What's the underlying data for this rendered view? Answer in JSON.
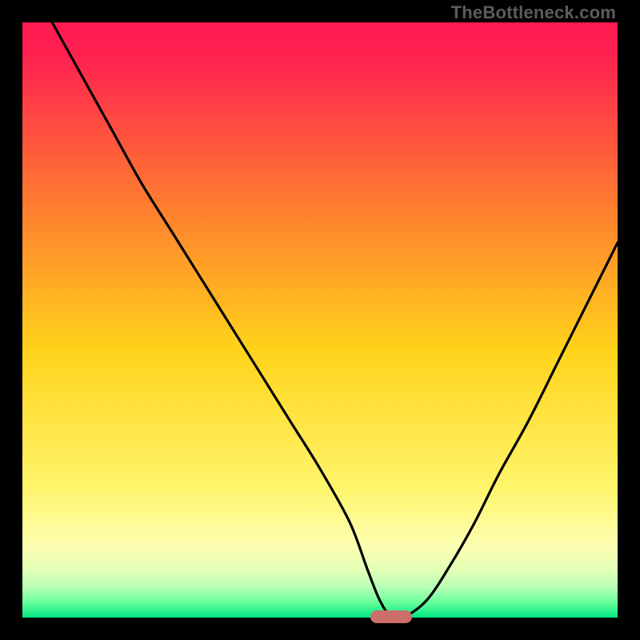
{
  "watermark": "TheBottleneck.com",
  "chart_data": {
    "type": "line",
    "title": "",
    "xlabel": "",
    "ylabel": "",
    "xlim": [
      0,
      100
    ],
    "ylim": [
      0,
      100
    ],
    "grid": false,
    "legend": false,
    "background_gradient": {
      "stops": [
        {
          "pct": 0.0,
          "color": "#ff1a52"
        },
        {
          "pct": 0.05,
          "color": "#ff2050"
        },
        {
          "pct": 0.3,
          "color": "#ff7a30"
        },
        {
          "pct": 0.55,
          "color": "#ffd31a"
        },
        {
          "pct": 0.78,
          "color": "#fff56a"
        },
        {
          "pct": 0.88,
          "color": "#fdffb2"
        },
        {
          "pct": 0.92,
          "color": "#e2ffb5"
        },
        {
          "pct": 0.95,
          "color": "#b6ffb6"
        },
        {
          "pct": 0.975,
          "color": "#66ff9a"
        },
        {
          "pct": 1.0,
          "color": "#00e884"
        }
      ]
    },
    "series": [
      {
        "name": "bottleneck-curve",
        "x": [
          5,
          10,
          15,
          20,
          25,
          30,
          35,
          40,
          45,
          50,
          55,
          58,
          60,
          62,
          64,
          68,
          72,
          76,
          80,
          85,
          90,
          95,
          100
        ],
        "y": [
          100,
          91,
          82,
          73,
          65,
          57,
          49,
          41,
          33,
          25,
          16,
          8,
          3,
          0,
          0,
          3,
          9,
          16,
          24,
          33,
          43,
          53,
          63
        ]
      }
    ],
    "annotations": [
      {
        "type": "pill",
        "name": "optimal-marker",
        "x": 62,
        "y": 0,
        "color": "#cc6e69"
      }
    ]
  }
}
